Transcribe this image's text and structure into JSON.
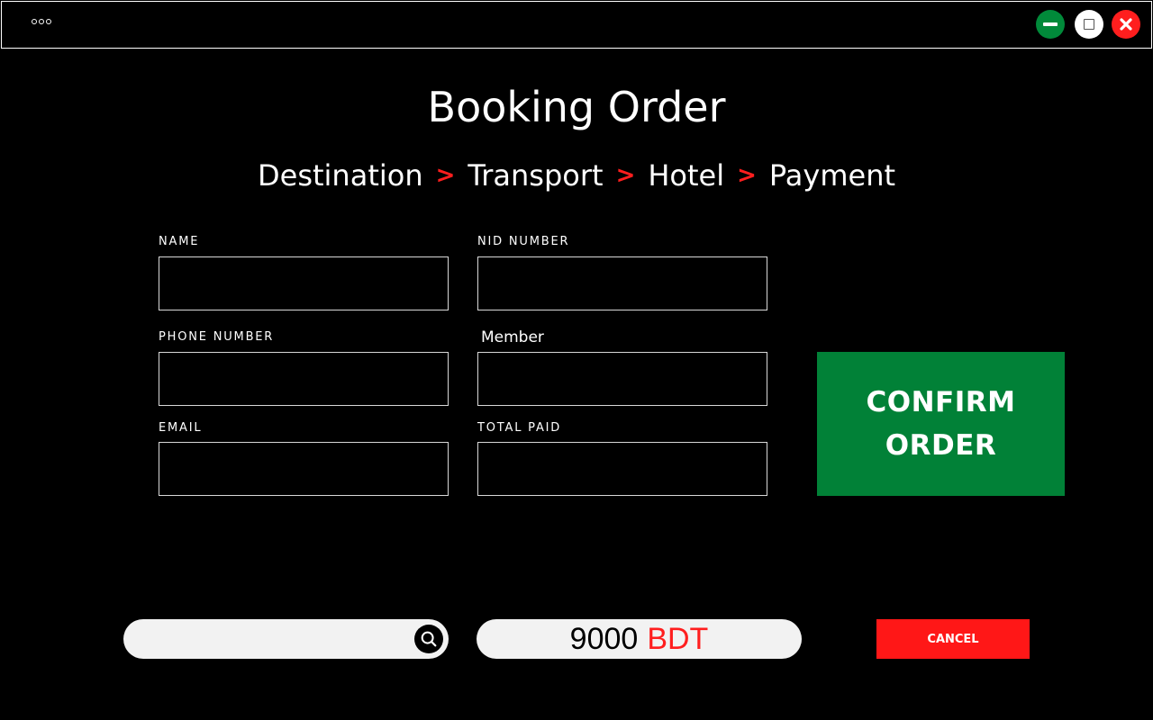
{
  "window": {
    "menu_icon": "three-dots-icon",
    "controls": {
      "minimize_icon": "minimize-icon",
      "maximize_icon": "maximize-icon",
      "close_icon": "close-icon"
    }
  },
  "page": {
    "title": "Booking Order"
  },
  "steps": [
    {
      "label": "Destination"
    },
    {
      "label": "Transport"
    },
    {
      "label": "Hotel"
    },
    {
      "label": "Payment"
    }
  ],
  "step_separator": ">",
  "form": {
    "name": {
      "label": "NAME",
      "value": "",
      "placeholder": ""
    },
    "nid": {
      "label": "NID NUMBER",
      "value": "",
      "placeholder": ""
    },
    "phone": {
      "label": "PHONE NUMBER",
      "value": "",
      "placeholder": ""
    },
    "member": {
      "label": "Member",
      "value": "",
      "placeholder": ""
    },
    "email": {
      "label": "EMAIL",
      "value": "",
      "placeholder": ""
    },
    "total_paid": {
      "label": "TOTAL PAID",
      "value": "",
      "placeholder": ""
    }
  },
  "confirm_button": {
    "line1": "CONFIRM",
    "line2": "ORDER"
  },
  "search": {
    "value": "",
    "placeholder": "",
    "icon": "search-icon"
  },
  "amount": {
    "value": "9000",
    "currency": "BDT"
  },
  "cancel_button": {
    "label": "CANCEL"
  },
  "colors": {
    "background": "#000000",
    "accent_green": "#018137",
    "accent_red": "#ff1717",
    "field_border": "#d8d8d8",
    "pill_background": "#f2f2f2"
  }
}
